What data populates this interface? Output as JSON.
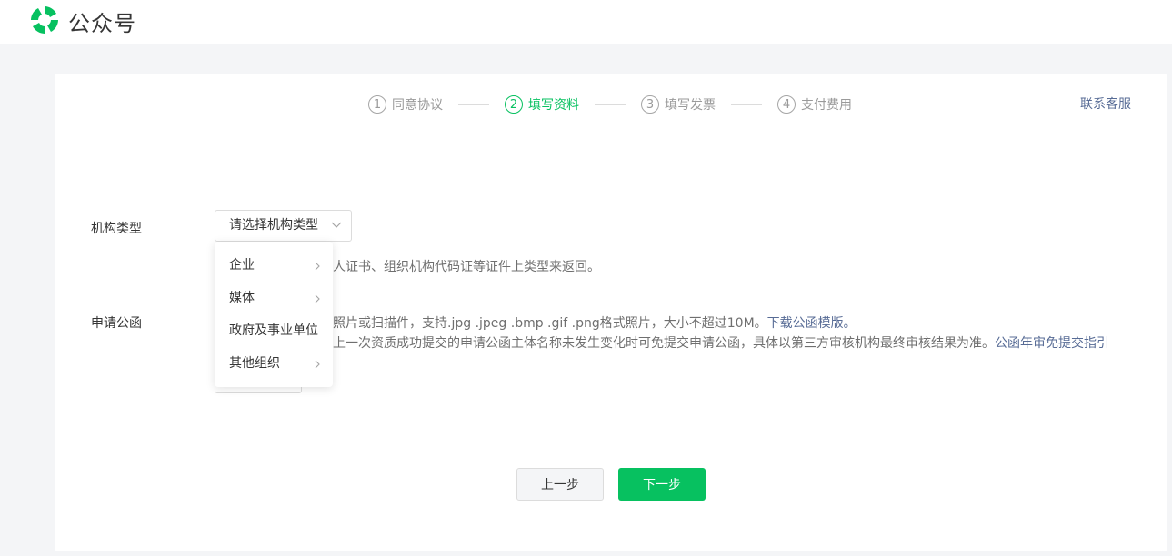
{
  "header": {
    "brand": "公众号",
    "logo_icon": "wechat-official-account-logo",
    "brand_color": "#07c160"
  },
  "steps": [
    {
      "num": "1",
      "label": "同意协议",
      "active": false
    },
    {
      "num": "2",
      "label": "填写资料",
      "active": true
    },
    {
      "num": "3",
      "label": "填写发票",
      "active": false
    },
    {
      "num": "4",
      "label": "支付费用",
      "active": false
    }
  ],
  "contact_label": "联系客服",
  "form": {
    "org_type": {
      "label": "机构类型",
      "select_placeholder": "请选择机构类型",
      "hint_visible": "人证书、组织机构代码证等证件上类型来返回。"
    },
    "application_letter": {
      "label": "申请公函",
      "hint_line1": "照片或扫描件，支持.jpg .jpeg .bmp .gif .png格式照片，大小不超过10M。",
      "hint_line1_link": "下载公函模版。",
      "hint_line2": "上一次资质成功提交的申请公函主体名称未发生变化时可免提交申请公函，具体以第三方审核机构最终审核结果为准。",
      "hint_line2_link": "公函年审免提交指引"
    }
  },
  "dropdown": {
    "items": [
      {
        "label": "企业",
        "has_children": true
      },
      {
        "label": "媒体",
        "has_children": true
      },
      {
        "label": "政府及事业单位",
        "has_children": false
      },
      {
        "label": "其他组织",
        "has_children": true
      }
    ]
  },
  "buttons": {
    "prev": "上一步",
    "next": "下一步"
  },
  "colors": {
    "accent": "#07c160",
    "link": "#576b95",
    "background": "#f4f5f7"
  }
}
